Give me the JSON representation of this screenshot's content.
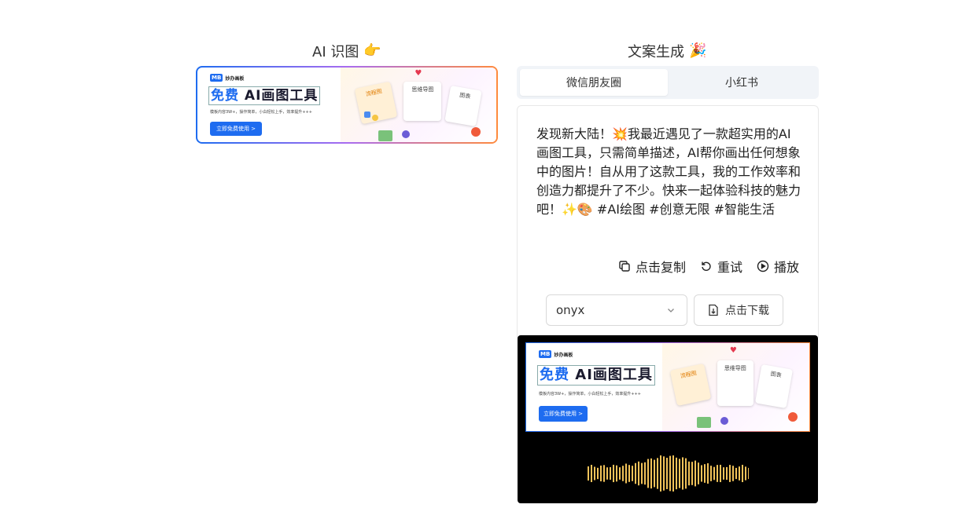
{
  "left": {
    "title": "AI 识图",
    "title_icon": "pointing-hand-icon"
  },
  "right": {
    "title": "文案生成",
    "title_icon": "party-popper-icon",
    "tabs": [
      {
        "label": "微信朋友圈",
        "active": true
      },
      {
        "label": "小红书",
        "active": false
      }
    ],
    "copy_text": "发现新大陆！💥我最近遇见了一款超实用的AI画图工具，只需简单描述，AI帮你画出任何想象中的图片！自从用了这款工具，我的工作效率和创造力都提升了不少。快来一起体验科技的魅力吧！✨🎨 #AI绘图 #创意无限 #智能生活",
    "actions": {
      "copy": "点击复制",
      "retry": "重试",
      "play": "播放"
    },
    "voice_select": {
      "value": "onyx"
    },
    "download_label": "点击下载"
  },
  "banner": {
    "logo_text": "妙办画板",
    "title_free": "免费",
    "title_rest": "AI画图工具",
    "desc": "模板内容3W+，操作简单，小白轻松上手，效率提升+++",
    "button": "立即免费使用 >",
    "card_flow": "流程图",
    "card_mind": "思维导图",
    "card_chart": "图表"
  }
}
